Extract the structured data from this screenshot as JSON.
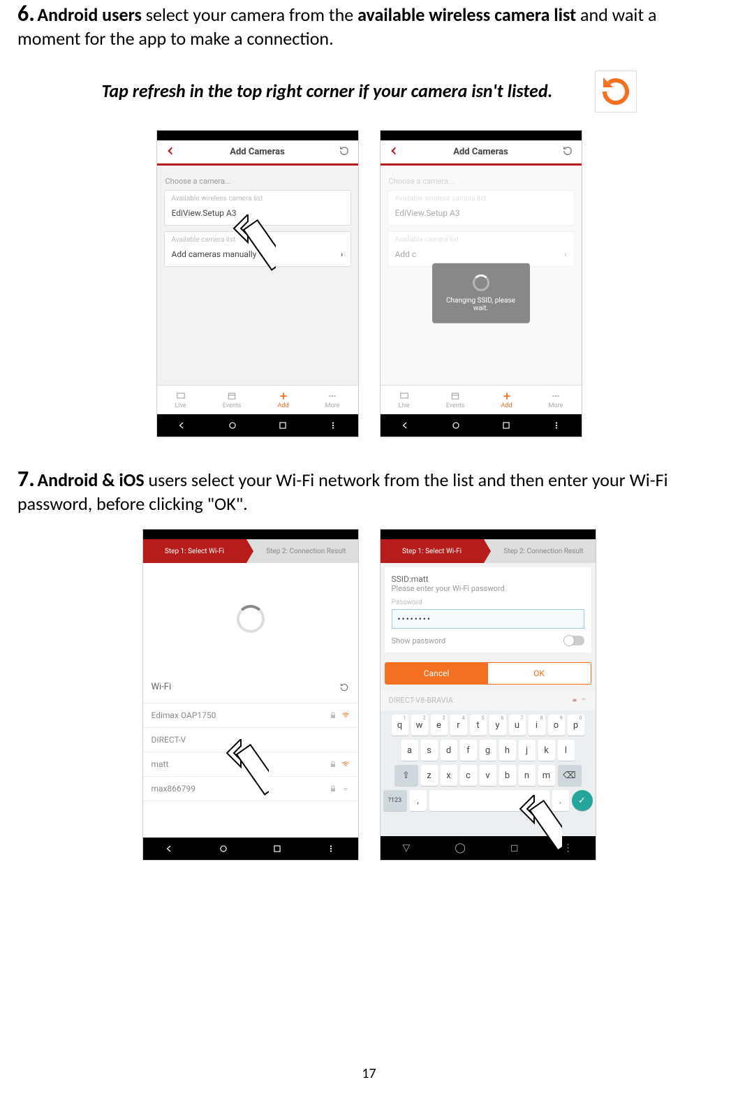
{
  "step6": {
    "num": "6.",
    "lead_bold": "Android users",
    "mid": " select your camera from the ",
    "mid_bold": "available wireless camera list",
    "tail": " and wait a moment for the app to make a connection.",
    "tip": "Tap refresh in the top right corner if your camera  isn't listed."
  },
  "shotA": {
    "title": "Add Cameras",
    "choose": "Choose a camera...",
    "card1_label": "Available wireless camera list",
    "card1_item": "EdiView.Setup A3",
    "card2_label": "Available camera list",
    "card2_item": "Add cameras manually",
    "tabs": {
      "live": "Live",
      "events": "Events",
      "add": "Add",
      "more": "More"
    }
  },
  "shotB": {
    "title": "Add Cameras",
    "choose": "Choose a camera...",
    "card1_label": "Available wireless camera list",
    "card1_item": "EdiView.Setup A3",
    "card2_label": "Available camera list",
    "card2_item": "Add c",
    "toast": "Changing SSID, please wait.",
    "tabs": {
      "live": "Live",
      "events": "Events",
      "add": "Add",
      "more": "More"
    }
  },
  "step7": {
    "num": "7.",
    "lead_bold": "Android & iOS",
    "tail": " users select your Wi-Fi network from the list and then enter your Wi-Fi password, before clicking \"OK\"."
  },
  "shotC": {
    "step1": "Step 1: Select Wi-Fi",
    "step2": "Step 2: Connection Result",
    "wifi_header": "Wi-Fi",
    "rows": [
      "Edimax OAP1750",
      "DIRECT-V",
      "matt",
      "max866799"
    ]
  },
  "shotD": {
    "step1": "Step 1: Select Wi-Fi",
    "step2": "Step 2: Connection Result",
    "ssid_label": "SSID:matt",
    "ssid_sub": "Please enter your Wi-Fi password",
    "pw_label": "Password",
    "pw_value": "••••••••",
    "show_pw": "Show password",
    "cancel": "Cancel",
    "ok": "OK",
    "dim_row": "DIRECT-V8-BRAVIA",
    "keys_r1": [
      "q",
      "w",
      "e",
      "r",
      "t",
      "y",
      "u",
      "i",
      "o",
      "p"
    ],
    "keys_r1_sup": [
      "1",
      "2",
      "3",
      "4",
      "5",
      "6",
      "7",
      "8",
      "9",
      "0"
    ],
    "keys_r2": [
      "a",
      "s",
      "d",
      "f",
      "g",
      "h",
      "j",
      "k",
      "l"
    ],
    "keys_r3": [
      "z",
      "x",
      "c",
      "v",
      "b",
      "n",
      "m"
    ],
    "sym": "?123",
    "comma": ",",
    "dot": "."
  },
  "page_number": "17"
}
